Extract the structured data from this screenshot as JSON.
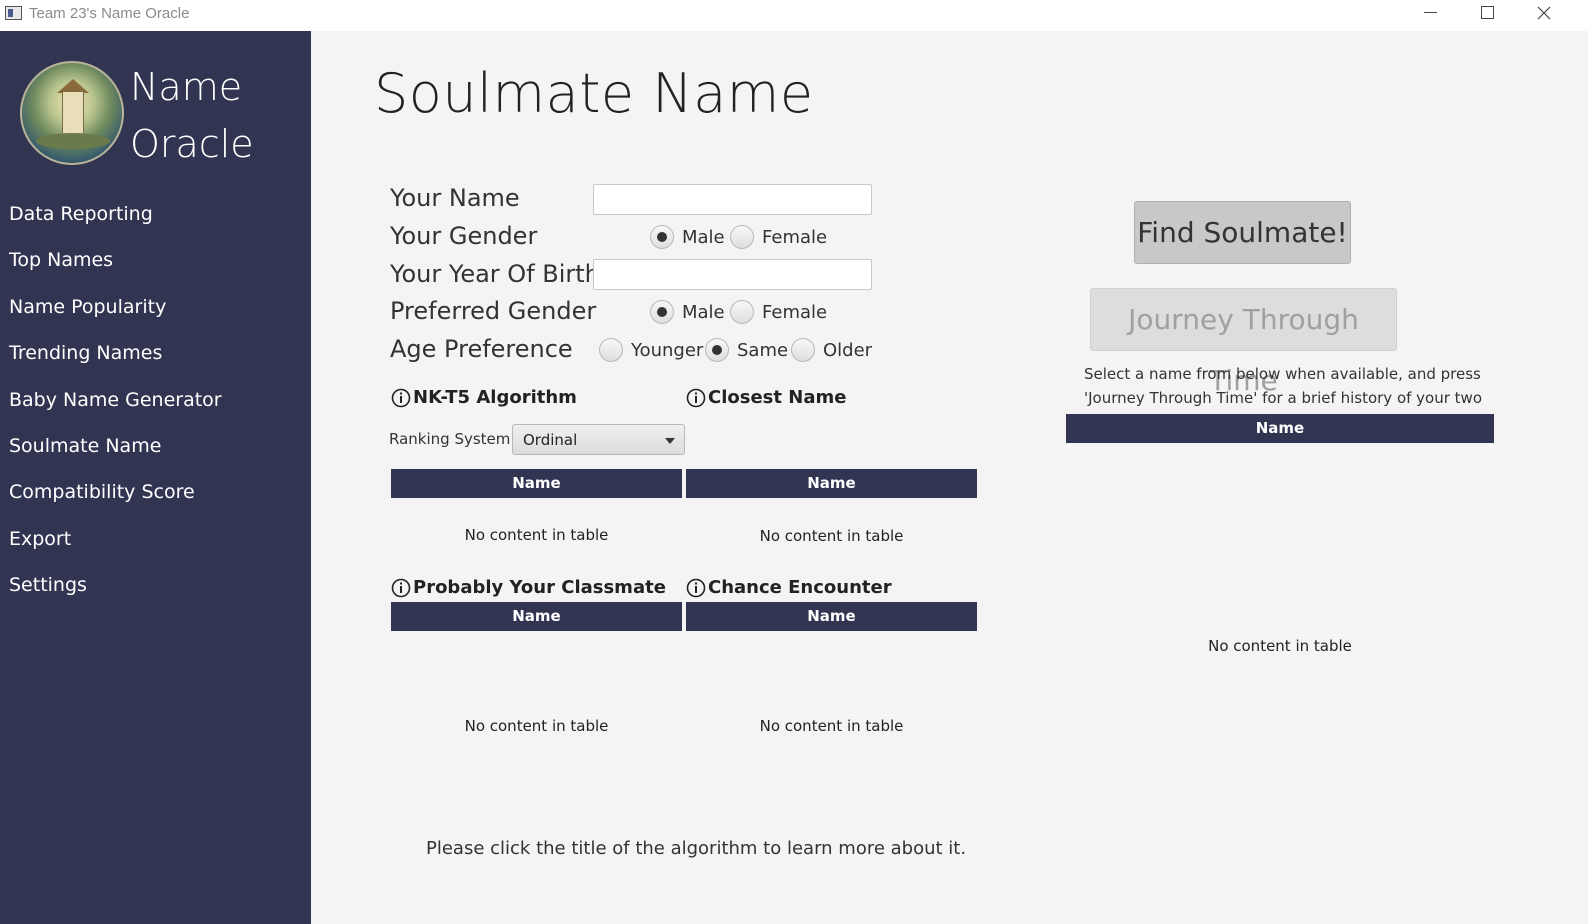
{
  "window": {
    "title": "Team 23's Name Oracle"
  },
  "brand": {
    "line1": "Name",
    "line2": "Oracle"
  },
  "nav": {
    "items": [
      {
        "label": "Data Reporting"
      },
      {
        "label": "Top Names"
      },
      {
        "label": "Name Popularity"
      },
      {
        "label": "Trending Names"
      },
      {
        "label": "Baby Name Generator"
      },
      {
        "label": "Soulmate Name"
      },
      {
        "label": "Compatibility Score"
      },
      {
        "label": "Export"
      },
      {
        "label": "Settings"
      }
    ]
  },
  "page": {
    "title": "Soulmate Name"
  },
  "form": {
    "your_name": {
      "label": "Your Name",
      "value": ""
    },
    "your_gender": {
      "label": "Your Gender",
      "options": [
        "Male",
        "Female"
      ],
      "selected": "Male"
    },
    "year_of_birth": {
      "label": "Your Year Of Birth",
      "value": ""
    },
    "preferred_gender": {
      "label": "Preferred Gender",
      "options": [
        "Male",
        "Female"
      ],
      "selected": "Male"
    },
    "age_preference": {
      "label": "Age Preference",
      "options": [
        "Younger",
        "Same",
        "Older"
      ],
      "selected": "Same"
    }
  },
  "algorithms": {
    "nk_t5": {
      "title": "NK-T5 Algorithm",
      "column": "Name",
      "empty": "No content in table"
    },
    "closest": {
      "title": "Closest Name",
      "column": "Name",
      "empty": "No content in table"
    },
    "classmate": {
      "title": "Probably Your Classmate",
      "column": "Name",
      "empty": "No content in table"
    },
    "chance": {
      "title": "Chance Encounter",
      "column": "Name",
      "empty": "No content in table"
    }
  },
  "ranking": {
    "label": "Ranking System",
    "selected": "Ordinal"
  },
  "actions": {
    "find": "Find Soulmate!",
    "journey": "Journey Through Time"
  },
  "hint": "Select a name from below when available, and press 'Journey Through Time' for a brief history of your two names.",
  "result_table": {
    "column": "Name",
    "empty": "No content in table"
  },
  "footer_note": "Please click the title of the algorithm to learn more about it."
}
